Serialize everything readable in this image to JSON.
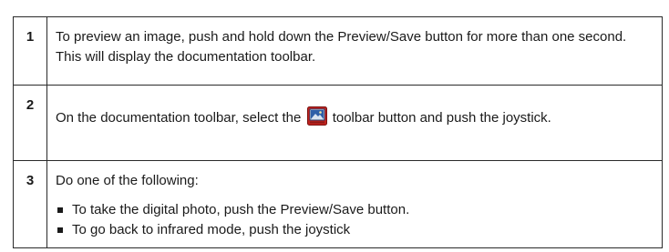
{
  "steps": [
    {
      "number": "1",
      "text": "To preview an image, push and hold down the Preview/Save button for more than one second. This will display the documentation toolbar."
    },
    {
      "number": "2",
      "text_before_icon": "On the documentation toolbar, select the",
      "icon": "image-toolbar-button-icon",
      "text_after_icon": "toolbar button and push the joystick."
    },
    {
      "number": "3",
      "intro": "Do one of the following:",
      "bullets": [
        "To take the digital photo, push the Preview/Save button.",
        "To go back to infrared mode, push the joystick"
      ]
    }
  ],
  "colors": {
    "border": "#2a2a2a",
    "icon_red": "#c0221e",
    "icon_blue": "#2f5fa8"
  }
}
